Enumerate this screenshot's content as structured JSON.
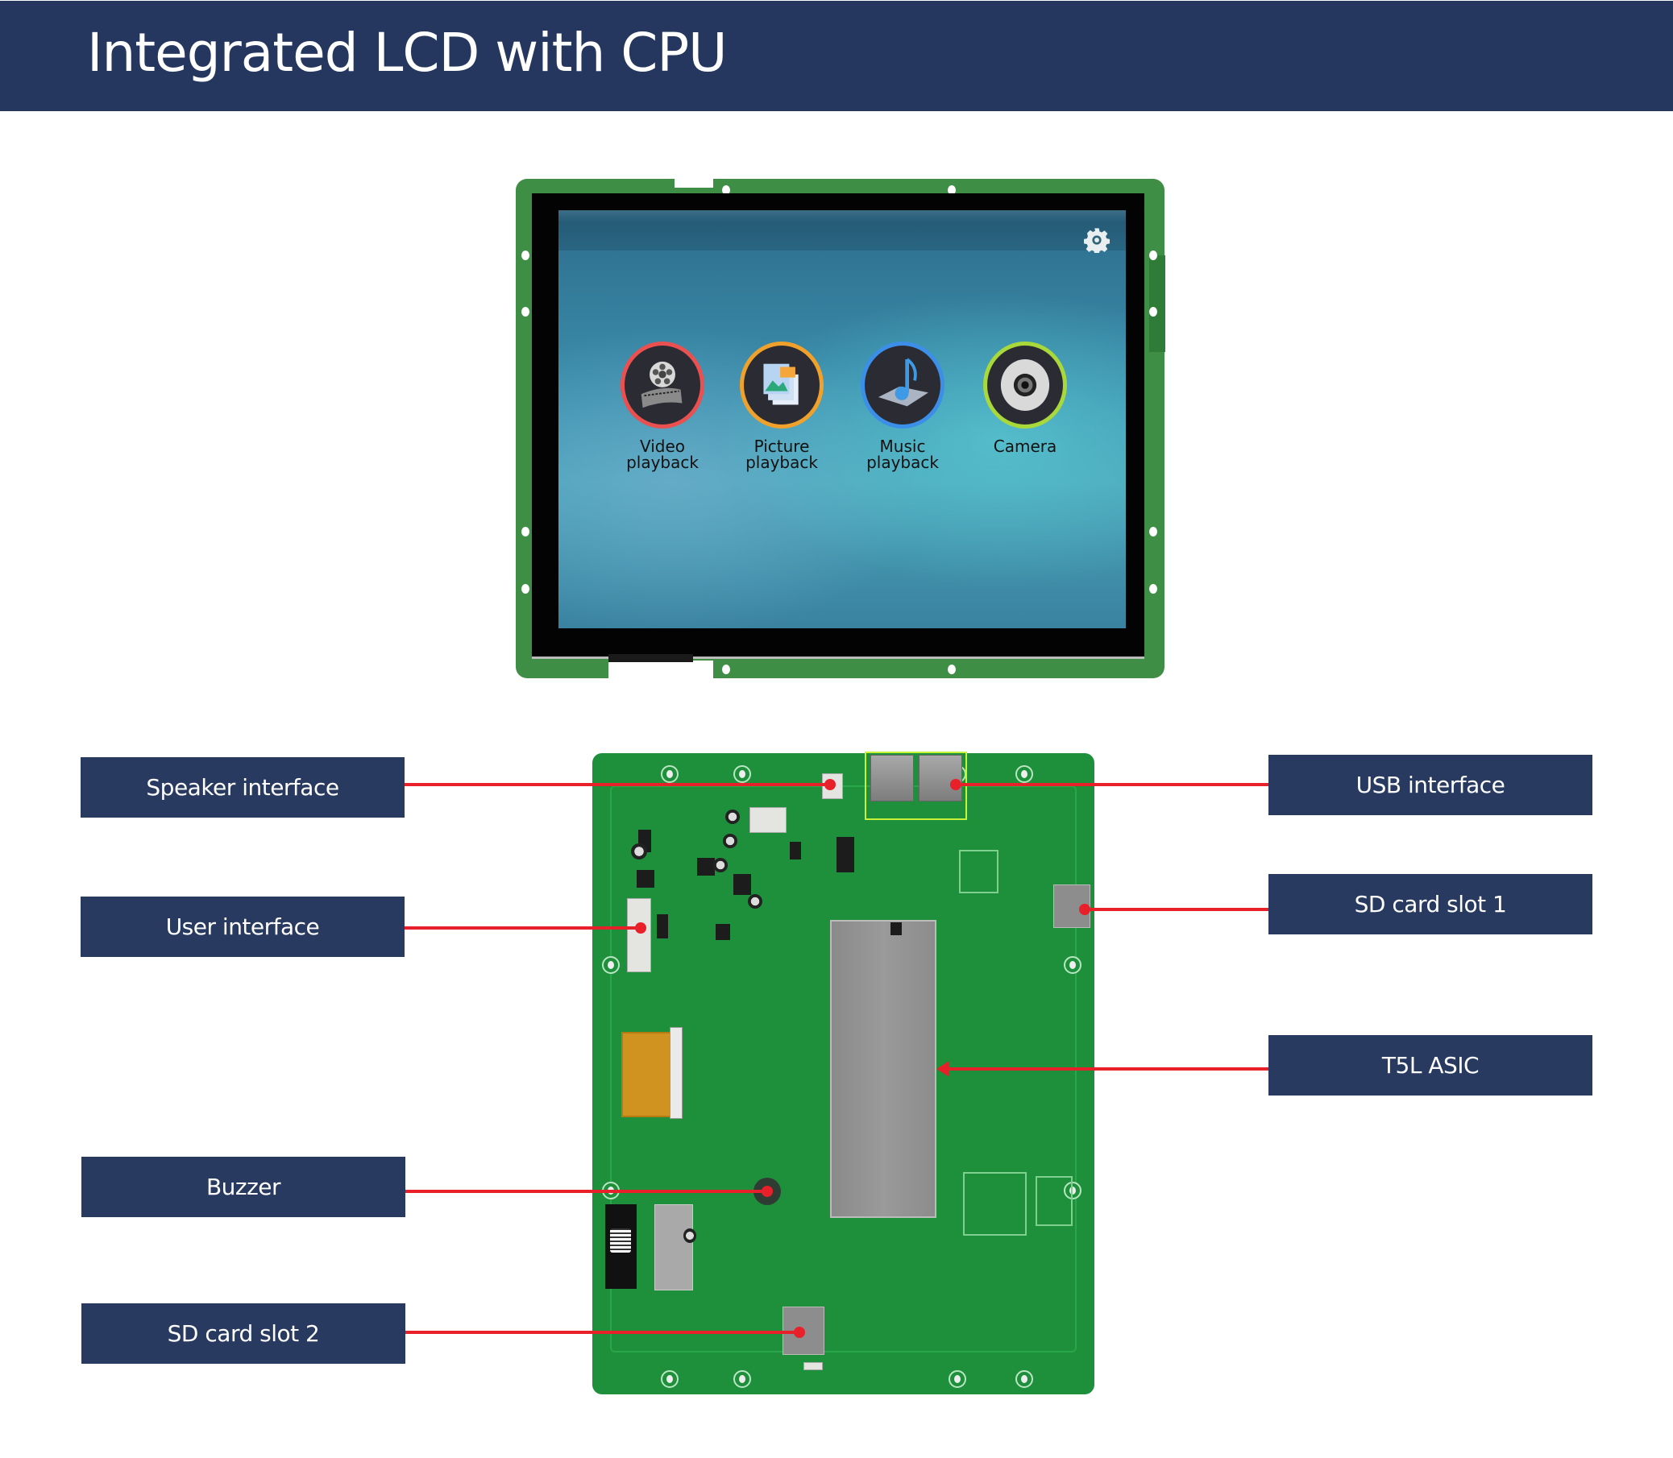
{
  "header": {
    "title": "Integrated LCD with CPU",
    "background_color": "#25375f"
  },
  "front_view": {
    "screen": {
      "settings_icon": "gear-icon",
      "apps": [
        {
          "label_line1": "Video",
          "label_line2": "playback",
          "icon": "film-reel-icon",
          "ring_color": "#e9504f"
        },
        {
          "label_line1": "Picture",
          "label_line2": "playback",
          "icon": "picture-icon",
          "ring_color": "#f0a12c"
        },
        {
          "label_line1": "Music",
          "label_line2": "playback",
          "icon": "music-note-icon",
          "ring_color": "#3b8fe8"
        },
        {
          "label_line1": "Camera",
          "label_line2": "",
          "icon": "webcam-icon",
          "ring_color": "#a9d83a"
        }
      ]
    }
  },
  "back_view": {
    "callouts_left": [
      {
        "label": "Speaker interface"
      },
      {
        "label": "User interface"
      },
      {
        "label": "Buzzer"
      },
      {
        "label": "SD card slot 2"
      }
    ],
    "callouts_right": [
      {
        "label": "USB interface"
      },
      {
        "label": "SD card slot 1"
      },
      {
        "label": "T5L ASIC"
      }
    ],
    "callout_color": "#293a61",
    "leader_color": "#e8202a",
    "highlight_color": "#c6f23a"
  }
}
